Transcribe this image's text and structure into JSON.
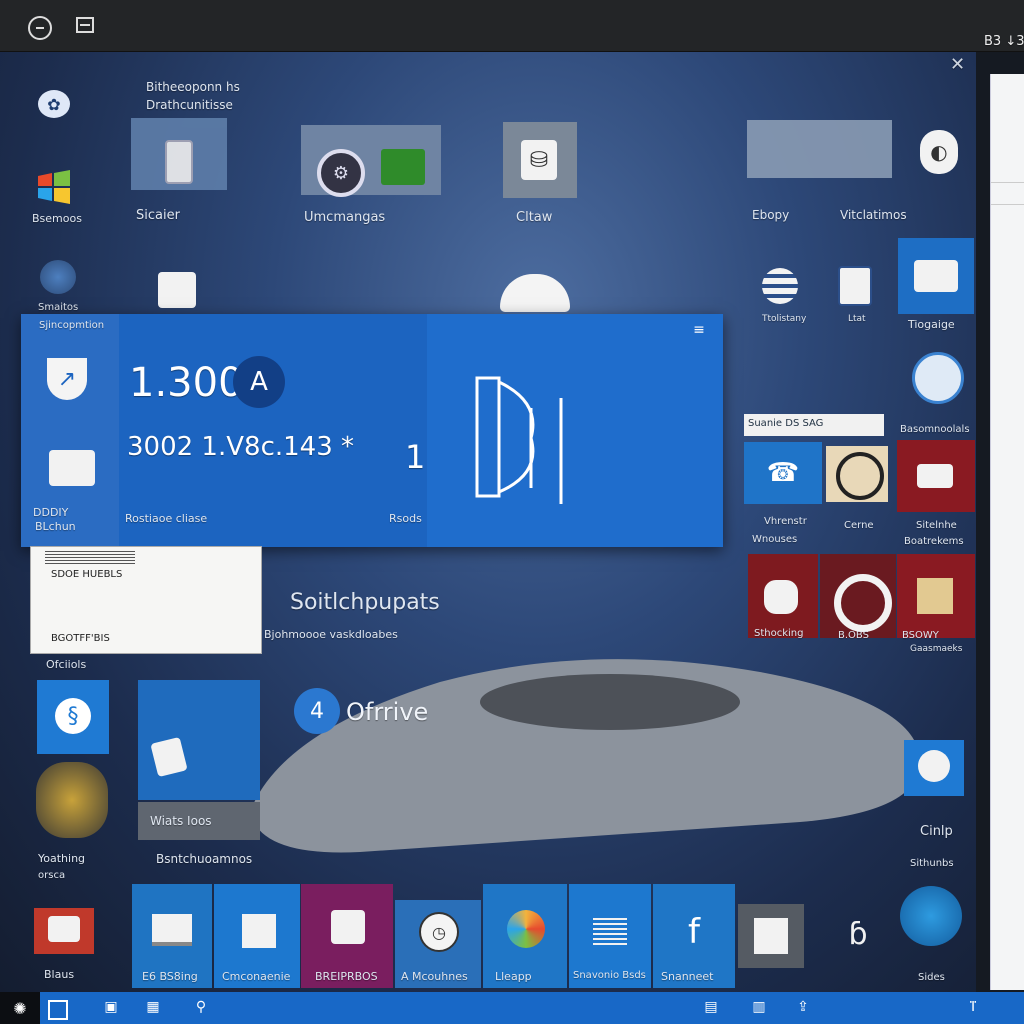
{
  "window": {
    "title_right": "B3 ↓3",
    "close_glyph": "✕"
  },
  "left_rail": {
    "items": [
      {
        "label": "Bsemoos"
      },
      {
        "label": "Smaitos"
      }
    ]
  },
  "header": {
    "line1": "Bitheeoponn hs",
    "line2": "Drathcunitisse"
  },
  "top_tiles": {
    "labels": [
      "Sicaier",
      "Umcmangas",
      "Cltaw",
      "Ebopy",
      "Vitclatimos"
    ]
  },
  "hero": {
    "left_label": "Sjincopmtion",
    "left_bottom_line1": "DDDIY",
    "left_bottom_line2": "BLchun",
    "value1": "1.300",
    "badge": "A",
    "value2": "3002  1.V8c.143 *",
    "side_number": "1",
    "footer_left": "Rostiaoe cliase",
    "footer_right": "Rsods"
  },
  "right_column": {
    "small_labels": [
      "Ttolistany",
      "Ltat",
      "Tiogaige"
    ],
    "mid_header_left": "Suanie DS SAG",
    "mid_header_right": "Basomnoolals",
    "labels_row1": [
      "Vhrenstr",
      "Cerne",
      "Sitelnhe"
    ],
    "labels_row1b": [
      "Wnouses",
      "Boatrekems"
    ],
    "labels_row2": [
      "Sthocking",
      "B.OBS",
      "BSOWY"
    ],
    "labels_row2b": "Gaasmaeks",
    "bottom_labels": [
      "Cinlp",
      "Sithunbs",
      "Sides"
    ]
  },
  "doc_panel": {
    "line1": "SDOE HUEBLS",
    "line2": "BGOTFF'BIS",
    "caption": "Bjohmoooe vaskdloabes"
  },
  "center": {
    "headline": "Soitlchpupats",
    "drive_label": "Ofrrive",
    "drive_badge": "4"
  },
  "left_lower": {
    "label1": "Ofciiols",
    "label2": "Wiats Ioos",
    "label3": "Yoathing",
    "label4": "orsca",
    "label5": "Bsntchuoamnos",
    "label6": "Blaus"
  },
  "bottom_row": {
    "tiles": [
      {
        "label": "E6 BS8ing",
        "color": "#1f74c2"
      },
      {
        "label": "Cmconaenie",
        "color": "#1d78cf"
      },
      {
        "label": "BREIPRBOS",
        "color": "#7a1e5f"
      },
      {
        "label": "A Mcouhnes",
        "color": "#2a6fb8"
      },
      {
        "label": "Lleapp",
        "color": "#1f76c6"
      },
      {
        "label": "Snavonio Bsds",
        "color": "#1d78cf"
      },
      {
        "label": "Snanneet",
        "color": "#1f76c6"
      }
    ]
  },
  "taskbar": {
    "right_glyph": "ⴶ"
  },
  "colors": {
    "accent_blue": "#1868c7",
    "tile_blue": "#1f74c2",
    "tile_red": "#7e1a1f",
    "tile_magenta": "#7a1e5f"
  }
}
